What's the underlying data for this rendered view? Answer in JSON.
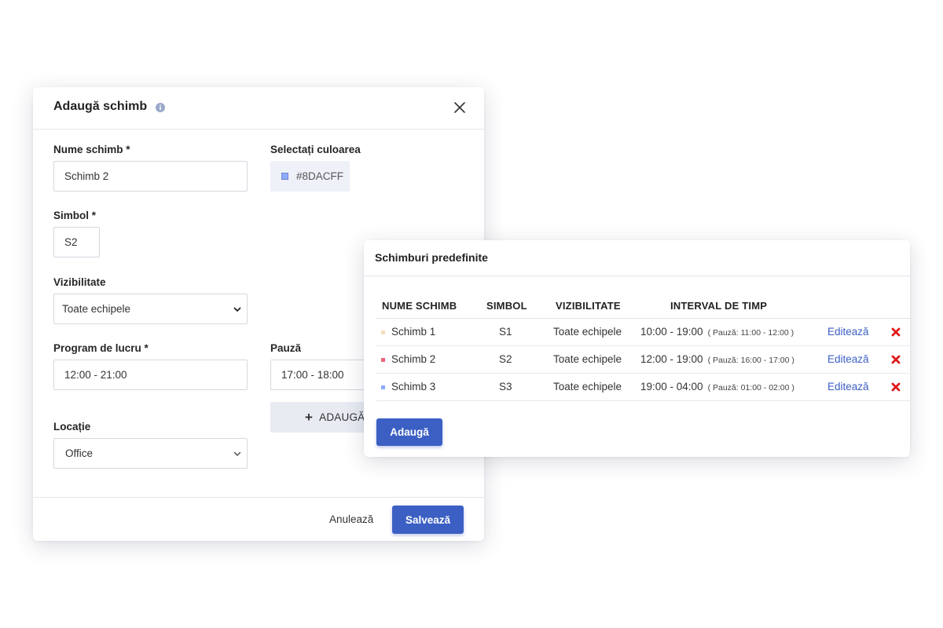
{
  "modal": {
    "title": "Adaugă schimb",
    "name_label": "Nume schimb  *",
    "name_value": "Schimb 2",
    "color_label": "Selectați culoarea",
    "color_value": "#8DACFF",
    "symbol_label": "Simbol *",
    "symbol_value": "S2",
    "visibility_label": "Vizibilitate",
    "visibility_value": "Toate echipele",
    "schedule_label": "Program de lucru *",
    "schedule_value": "12:00 - 21:00",
    "break_label": "Pauză",
    "break_value": "17:00 - 18:00",
    "add_break_label": "ADAUGĂ",
    "location_label": "Locație",
    "location_value": "Office",
    "cancel_label": "Anulează",
    "save_label": "Salvează"
  },
  "panel": {
    "title": "Schimburi predefinite",
    "columns": [
      "NUME SCHIMB",
      "SIMBOL",
      "VIZIBILITATE",
      "INTERVAL DE TIMP"
    ],
    "rows": [
      {
        "name": "Schimb 1",
        "symbol": "S1",
        "visibility": "Toate echipele",
        "interval": "10:00 - 19:00",
        "pause": "( Pauză: 11:00 - 12:00 )",
        "edit": "Editează",
        "color": "#f5dcc0"
      },
      {
        "name": "Schimb 2",
        "symbol": "S2",
        "visibility": "Toate echipele",
        "interval": "12:00 - 19:00",
        "pause": "( Pauză: 16:00 - 17:00 )",
        "edit": "Editează",
        "color": "#e8647a"
      },
      {
        "name": "Schimb 3",
        "symbol": "S3",
        "visibility": "Toate echipele",
        "interval": "19:00 - 04:00",
        "pause": "( Pauză: 01:00 - 02:00 )",
        "edit": "Editează",
        "color": "#8dacff"
      }
    ],
    "add_label": "Adaugă"
  },
  "colors": {
    "primary": "#3c5fc4",
    "delete": "#e01b1b",
    "info_icon": "#9aa9c9"
  },
  "icons": {
    "info": "info-icon",
    "close": "close-icon",
    "chevron": "chevron-down-icon",
    "plus": "plus-icon",
    "delete": "delete-x-icon"
  }
}
